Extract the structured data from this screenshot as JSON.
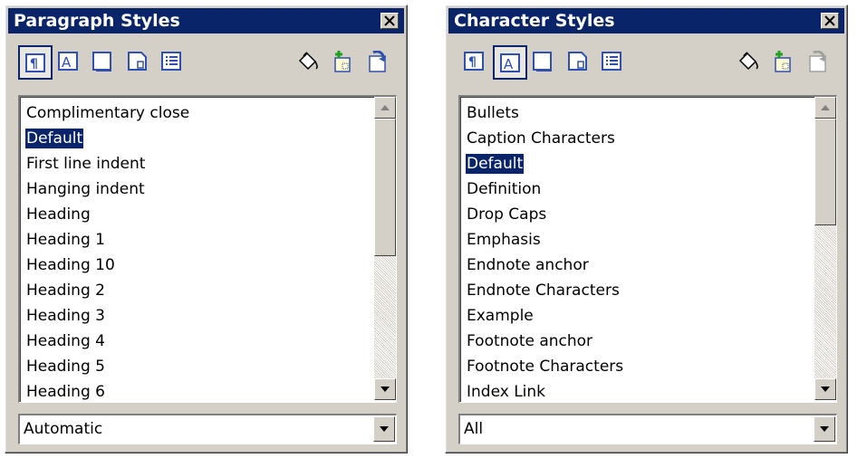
{
  "paragraph_panel": {
    "title": "Paragraph Styles",
    "active_category": "paragraph-styles",
    "toolbar": [
      "paragraph-styles-icon",
      "character-styles-icon",
      "frame-styles-icon",
      "page-styles-icon",
      "list-styles-icon",
      "fill-format-icon",
      "new-style-icon",
      "update-style-icon"
    ],
    "items": [
      "Complimentary close",
      "Default",
      "First line indent",
      "Hanging indent",
      "Heading",
      "Heading 1",
      "Heading 10",
      "Heading 2",
      "Heading 3",
      "Heading 4",
      "Heading 5",
      "Heading 6"
    ],
    "selected_item": "Default",
    "filter": "Automatic"
  },
  "character_panel": {
    "title": "Character Styles",
    "active_category": "character-styles",
    "toolbar": [
      "paragraph-styles-icon",
      "character-styles-icon",
      "frame-styles-icon",
      "page-styles-icon",
      "list-styles-icon",
      "fill-format-icon",
      "new-style-icon",
      "update-style-icon"
    ],
    "items": [
      "Bullets",
      "Caption Characters",
      "Default",
      "Definition",
      "Drop Caps",
      "Emphasis",
      "Endnote anchor",
      "Endnote Characters",
      "Example",
      "Footnote anchor",
      "Footnote Characters",
      "Index Link"
    ],
    "selected_item": "Default",
    "filter": "All"
  },
  "colors": {
    "titlebar": "#0a246a",
    "panel": "#d4d0c8",
    "selection": "#0a246a"
  }
}
